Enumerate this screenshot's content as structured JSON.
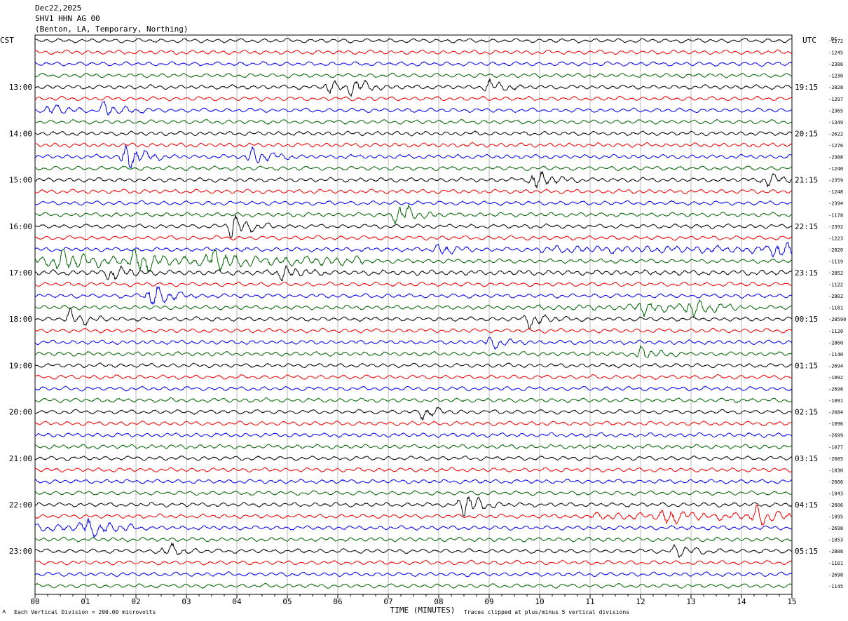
{
  "header": {
    "date": "Dec22,2025",
    "station": "SHV1 HHN AG 00",
    "location": "(Benton, LA, Temporary, Northing)"
  },
  "axes": {
    "left_label": "CST",
    "right_label": "UTC",
    "dc_label": "DC",
    "xlabel": "TIME (MINUTES)",
    "x_ticks": [
      "00",
      "01",
      "02",
      "03",
      "04",
      "05",
      "06",
      "07",
      "08",
      "09",
      "10",
      "11",
      "12",
      "13",
      "14",
      "15"
    ],
    "left_hours": [
      "13:00",
      "14:00",
      "15:00",
      "16:00",
      "17:00",
      "18:00",
      "19:00",
      "20:00",
      "21:00",
      "22:00",
      "23:00"
    ],
    "right_hours": [
      "19:15",
      "20:15",
      "21:15",
      "22:15",
      "23:15",
      "00:15",
      "01:15",
      "02:15",
      "03:15",
      "04:15",
      "05:15"
    ],
    "dc_offsets": [
      "-1272",
      "-1245",
      "-2386",
      "-1230",
      "-2828",
      "-1297",
      "-2365",
      "-1349",
      "-2622",
      "-1276",
      "-2388",
      "-1240",
      "-2359",
      "-1248",
      "-2394",
      "-1178",
      "-2392",
      "-1223",
      "-2820",
      "-1119",
      "-2852",
      "-1122",
      "-2802",
      "-1181",
      "-28590",
      "-1120",
      "-2860",
      "-1140",
      "-2694",
      "-1092",
      "-2698",
      "-1091",
      "-2684",
      "-1096",
      "-2699",
      "-1077",
      "-2685",
      "-1030",
      "-2666",
      "-1043",
      "-2606",
      "-1095",
      "-2698",
      "-1053",
      "-2888",
      "-1101",
      "-2698",
      "-1145"
    ]
  },
  "footer": {
    "scale_note": "Each Vertical Division =  200.00 microvolts",
    "clip_note": "Traces clipped at plus/minus 5 vertical divisions",
    "corner_mark": "ᴧ"
  },
  "colors": [
    "#000000",
    "#ee0000",
    "#0000ee",
    "#006400"
  ],
  "chart_data": {
    "type": "helicorder",
    "traces_count": 48,
    "minutes_per_trace": 15,
    "x_range_minutes": [
      0,
      15
    ],
    "grid_vertical_every_minutes": 1,
    "amplitude_scale_microvolts_per_division": 200,
    "events": [
      {
        "trace": 4,
        "minute": 5.8,
        "strength": 1.6
      },
      {
        "trace": 4,
        "minute": 6.3,
        "strength": 1.7
      },
      {
        "trace": 4,
        "minute": 9.0,
        "strength": 1.4
      },
      {
        "trace": 6,
        "minute": 1.4,
        "strength": 2.0
      },
      {
        "trace": 6,
        "minute": 0.3,
        "strength": 1.5
      },
      {
        "trace": 10,
        "minute": 1.8,
        "strength": 3.5
      },
      {
        "trace": 10,
        "minute": 4.3,
        "strength": 2.3
      },
      {
        "trace": 12,
        "minute": 9.9,
        "strength": 2.4
      },
      {
        "trace": 12,
        "minute": 14.5,
        "strength": 1.5
      },
      {
        "trace": 15,
        "minute": 7.2,
        "strength": 2.8
      },
      {
        "trace": 16,
        "minute": 3.9,
        "strength": 3.2
      },
      {
        "trace": 18,
        "minute": 14.7,
        "strength": 2.0
      },
      {
        "trace": 18,
        "minute": 8.0,
        "strength": 1.4
      },
      {
        "trace": 19,
        "minute": 2.0,
        "strength": 3.0
      },
      {
        "trace": 19,
        "minute": 0.5,
        "strength": 2.6
      },
      {
        "trace": 19,
        "minute": 3.5,
        "strength": 2.6
      },
      {
        "trace": 20,
        "minute": 1.5,
        "strength": 1.8
      },
      {
        "trace": 20,
        "minute": 4.9,
        "strength": 1.6
      },
      {
        "trace": 22,
        "minute": 2.3,
        "strength": 3.3
      },
      {
        "trace": 23,
        "minute": 12.0,
        "strength": 1.8
      },
      {
        "trace": 23,
        "minute": 13.0,
        "strength": 2.6
      },
      {
        "trace": 24,
        "minute": 0.7,
        "strength": 2.0
      },
      {
        "trace": 24,
        "minute": 9.8,
        "strength": 1.8
      },
      {
        "trace": 26,
        "minute": 9.0,
        "strength": 1.4
      },
      {
        "trace": 27,
        "minute": 12.0,
        "strength": 1.6
      },
      {
        "trace": 32,
        "minute": 7.7,
        "strength": 1.5
      },
      {
        "trace": 40,
        "minute": 8.5,
        "strength": 3.4
      },
      {
        "trace": 41,
        "minute": 12.5,
        "strength": 1.9
      },
      {
        "trace": 41,
        "minute": 14.3,
        "strength": 2.0
      },
      {
        "trace": 42,
        "minute": 1.0,
        "strength": 2.2
      },
      {
        "trace": 44,
        "minute": 2.6,
        "strength": 1.5
      },
      {
        "trace": 44,
        "minute": 12.7,
        "strength": 1.6
      }
    ],
    "noisy_segments": [
      {
        "trace": 18,
        "start": 10.0,
        "end": 15.0,
        "gain": 1.8
      },
      {
        "trace": 19,
        "start": 0.0,
        "end": 6.5,
        "gain": 2.3
      },
      {
        "trace": 20,
        "start": 0.0,
        "end": 15.0,
        "gain": 1.25
      },
      {
        "trace": 23,
        "start": 10.0,
        "end": 14.0,
        "gain": 1.4
      },
      {
        "trace": 41,
        "start": 11.0,
        "end": 15.0,
        "gain": 1.8
      },
      {
        "trace": 42,
        "start": 0.0,
        "end": 2.0,
        "gain": 1.8
      }
    ]
  }
}
